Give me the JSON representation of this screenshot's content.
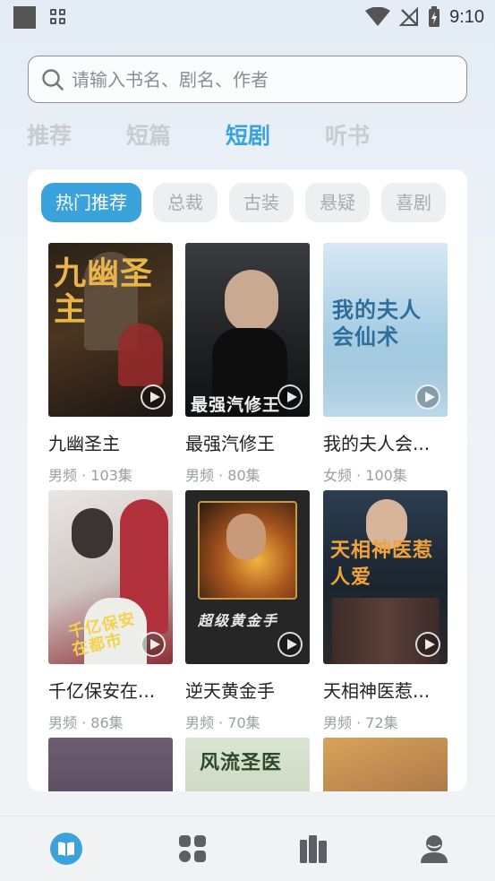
{
  "status_bar": {
    "time": "9:10"
  },
  "search": {
    "placeholder": "请输入书名、剧名、作者"
  },
  "top_tabs": [
    {
      "label": "推荐",
      "active": false
    },
    {
      "label": "短篇",
      "active": false
    },
    {
      "label": "短剧",
      "active": true
    },
    {
      "label": "听书",
      "active": false
    }
  ],
  "chips": [
    {
      "label": "热门推荐",
      "active": true
    },
    {
      "label": "总裁",
      "active": false
    },
    {
      "label": "古装",
      "active": false
    },
    {
      "label": "悬疑",
      "active": false
    },
    {
      "label": "喜剧",
      "active": false
    }
  ],
  "items": [
    {
      "title": "九幽圣主",
      "meta": "男频 · 103集",
      "cover_text": "九幽圣主"
    },
    {
      "title": "最强汽修王",
      "meta": "男频 · 80集",
      "cover_text": "最强汽修王"
    },
    {
      "title": "我的夫人会...",
      "meta": "女频 · 100集",
      "cover_text": "我的夫人会仙术"
    },
    {
      "title": "千亿保安在...",
      "meta": "男频 · 86集",
      "cover_text": "千亿保安在都市"
    },
    {
      "title": "逆天黄金手",
      "meta": "男频 · 70集",
      "cover_text": "超级黄金手"
    },
    {
      "title": "天相神医惹...",
      "meta": "男频 · 72集",
      "cover_text": "天相神医惹人爱"
    },
    {
      "cover_text": ""
    },
    {
      "cover_text": "风流圣医"
    },
    {
      "cover_text": ""
    }
  ],
  "colors": {
    "accent": "#3aa3dc",
    "tab_inactive": "#c9cdd2",
    "chip_bg": "#eeeff1"
  },
  "bottom_nav": [
    {
      "icon": "book-icon",
      "active": true
    },
    {
      "icon": "category-icon",
      "active": false
    },
    {
      "icon": "bookshelf-icon",
      "active": false
    },
    {
      "icon": "profile-icon",
      "active": false
    }
  ]
}
